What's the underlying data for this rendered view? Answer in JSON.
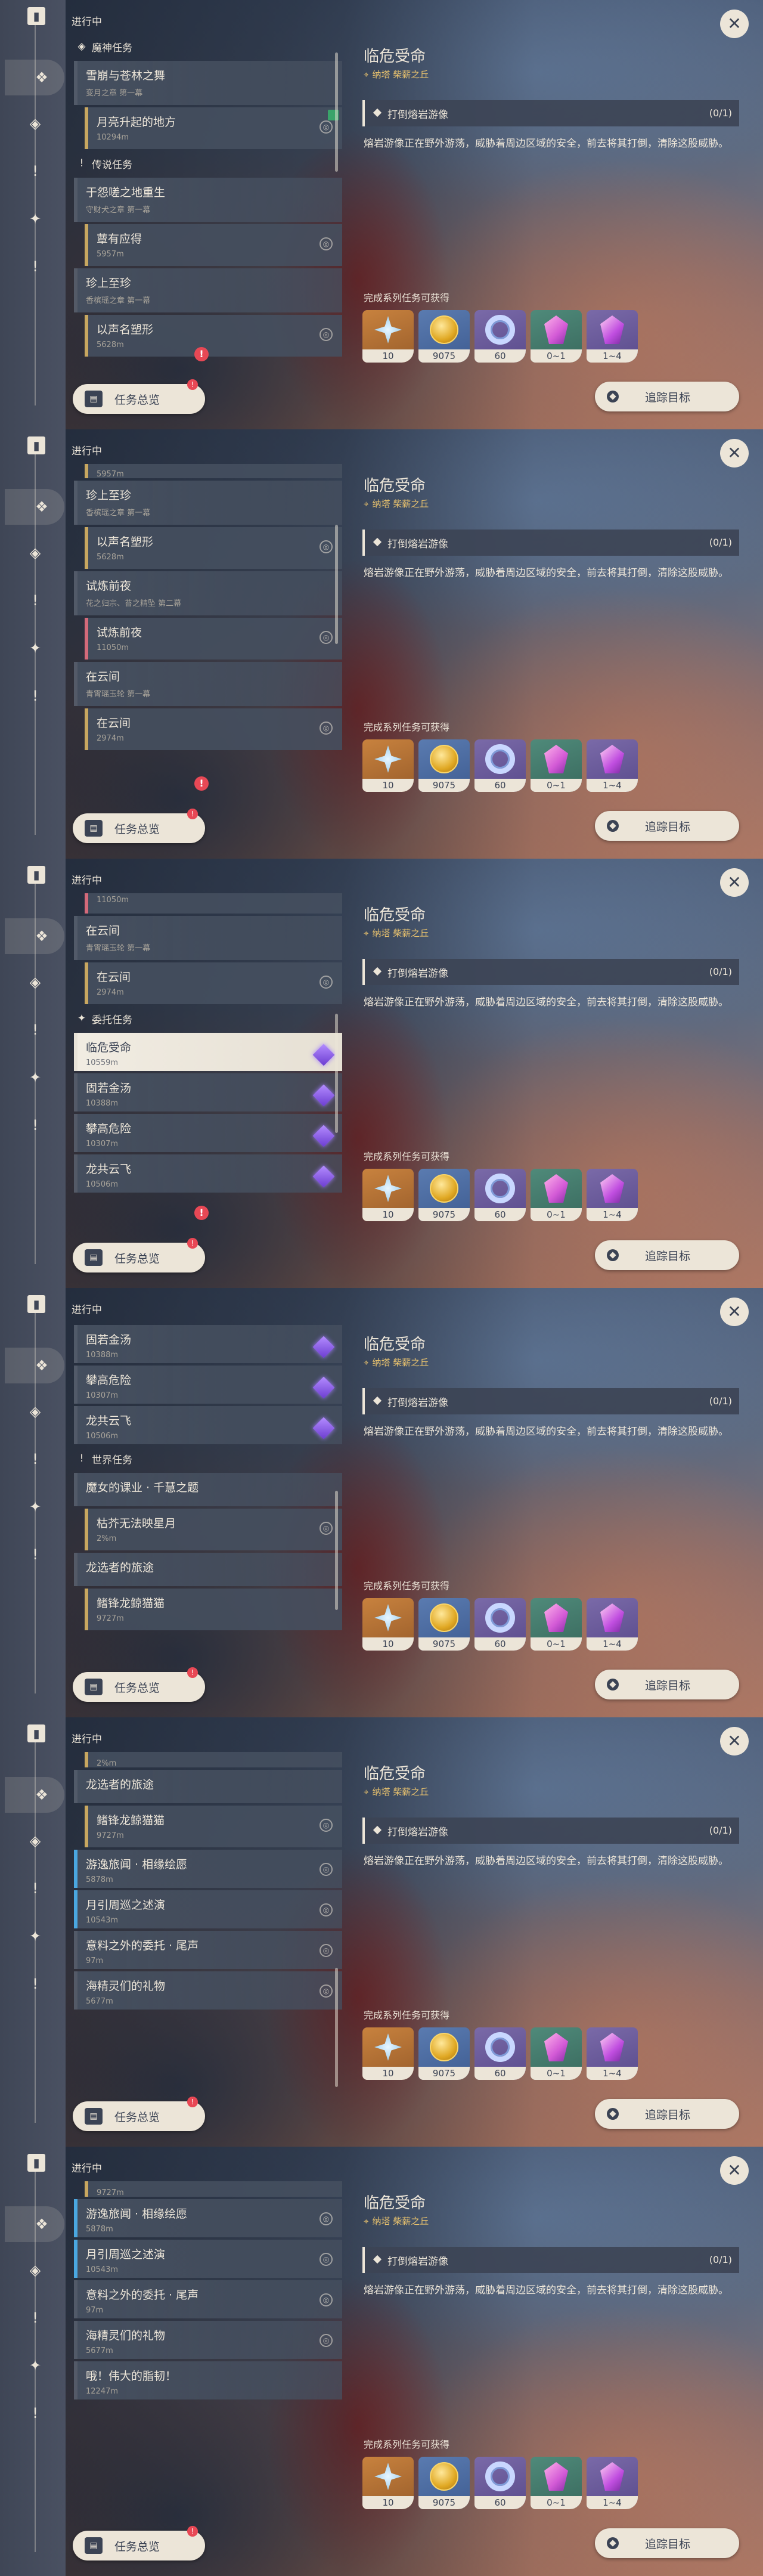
{
  "rail": {
    "book_icon": "quest-book-icon",
    "buttons": [
      {
        "icon": "all-quests-icon",
        "glyph": "❖"
      },
      {
        "icon": "archon-quest-icon",
        "glyph": "◈"
      },
      {
        "icon": "story-quest-icon",
        "glyph": "!"
      },
      {
        "icon": "commission-icon",
        "glyph": "✦"
      },
      {
        "icon": "world-quest-icon",
        "glyph": "!"
      }
    ]
  },
  "list": {
    "heading": "进行中",
    "overview_label": "任务总览",
    "overview_badge": "!"
  },
  "categories": {
    "archon": "魔神任务",
    "story": "传说任务",
    "commission": "委托任务",
    "world": "世界任务"
  },
  "quests": {
    "xueliu": {
      "title": "雪崩与苍林之舞",
      "sub": "变月之章 第一幕"
    },
    "yuesheng": {
      "title": "月亮升起的地方",
      "dist": "10294m"
    },
    "yuanshi": {
      "title": "于怨嗟之地重生",
      "sub": "守财犬之章 第一幕"
    },
    "gaoyou": {
      "title": "蕈有应得",
      "dist": "5957m"
    },
    "zhenshang": {
      "title": "珍上至珍",
      "sub": "香槟瑶之章 第一幕"
    },
    "yisheng": {
      "title": "以声名塑形",
      "dist": "5628m"
    },
    "shilian": {
      "title": "试炼前夜",
      "sub": "花之归宗、苔之精坠 第二幕"
    },
    "shilian_sub": {
      "title": "试炼前夜",
      "dist": "11050m"
    },
    "zaiyun": {
      "title": "在云间",
      "sub": "青霄瑶玉轮 第一幕"
    },
    "zaiyun_sub": {
      "title": "在云间",
      "dist": "2974m"
    },
    "mofa": {
      "title": "魔女的课业 · 千慧之题"
    },
    "kuzi": {
      "title": "枯芥无法映星月",
      "dist": "2%m"
    },
    "longxuan": {
      "title": "龙选者的旅途"
    },
    "jiafeng": {
      "title": "鳍锋龙鲸猫猫",
      "dist": "9727m"
    },
    "youxuan": {
      "title": "游逸旅闻 · 相缘绘愿",
      "dist": "5878m"
    },
    "yueyin": {
      "title": "月引周巡之述演",
      "dist": "10543m"
    },
    "yiliao": {
      "title": "意料之外的委托 · 尾声",
      "dist": "97m"
    },
    "haijing": {
      "title": "海精灵们的礼物",
      "dist": "5677m"
    },
    "ohwei": {
      "title": "哦！伟大的脂韧！",
      "dist": "12247m"
    }
  },
  "commissions": [
    {
      "title": "临危受命",
      "dist": "10559m"
    },
    {
      "title": "固若金汤",
      "dist": "10388m"
    },
    {
      "title": "攀高危险",
      "dist": "10307m"
    },
    {
      "title": "龙共云飞",
      "dist": "10506m"
    }
  ],
  "detail": {
    "title": "临危受命",
    "location": "纳塔 柴薪之丘",
    "objective": "打倒熔岩游像",
    "objective_count": "(0/1)",
    "description": "熔岩游像正在野外游荡，威胁着周边区域的安全，前去将其打倒，清除这股威胁。",
    "rewards_label": "完成系列任务可获得",
    "rewards": [
      {
        "icon": "primogem-star-icon",
        "qty": "10"
      },
      {
        "icon": "mora-coin-icon",
        "qty": "9075"
      },
      {
        "icon": "exp-ring-icon",
        "qty": "60"
      },
      {
        "icon": "green-crystal-icon",
        "qty": "0~1"
      },
      {
        "icon": "purple-crystal-icon",
        "qty": "1~4"
      }
    ],
    "track_label": "追踪目标",
    "close_glyph": "✕"
  },
  "colors": {
    "accent_gold": "#e8c26e",
    "panel": "#ece5d8",
    "alert": "#e84855",
    "commission_gem": "#a07cff"
  }
}
